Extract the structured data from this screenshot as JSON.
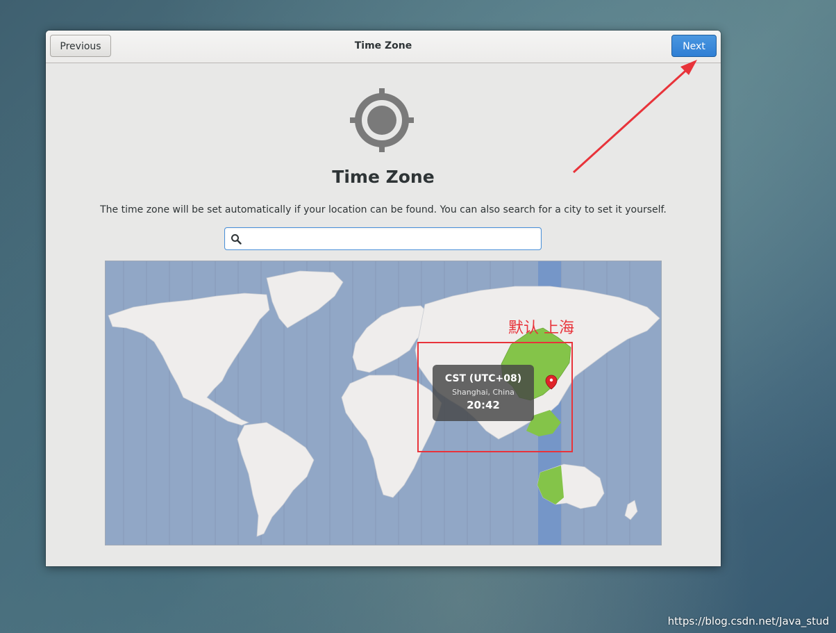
{
  "header": {
    "title": "Time Zone",
    "previous_label": "Previous",
    "next_label": "Next"
  },
  "main": {
    "title": "Time Zone",
    "description": "The time zone will be set automatically if your location can be found. You can also search for a city to set it yourself.",
    "search_value": "",
    "search_placeholder": ""
  },
  "map": {
    "selected_timezone": "CST (UTC+08)",
    "selected_city": "Shanghai, China",
    "current_time": "20:42",
    "colors": {
      "ocean": "#91a7c6",
      "land": "#efedec",
      "selected_land": "#84c449",
      "selected_band": "#7596c8",
      "marker": "#e0242a"
    }
  },
  "annotations": {
    "label": "默认 上海",
    "color": "#e8333a"
  },
  "watermark": "https://blog.csdn.net/Java_stud"
}
